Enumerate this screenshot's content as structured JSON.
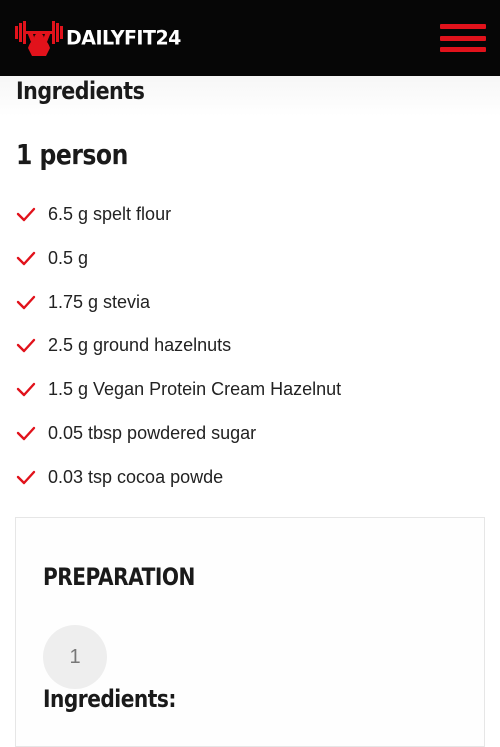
{
  "header": {
    "logo_text": "DAILYFIT24",
    "logo_icon": "bodybuilder-barbell-icon",
    "menu_icon": "hamburger-menu-icon",
    "accent_color": "#e1121b"
  },
  "ingredients": {
    "title": "Ingredients",
    "servings": "1 person",
    "check_icon": "checkmark-icon",
    "items": [
      "6.5 g spelt flour",
      "0.5 g",
      "1.75 g stevia",
      "2.5 g ground hazelnuts",
      "1.5 g Vegan Protein Cream Hazelnut",
      "0.05 tbsp powdered sugar",
      "0.03 tsp cocoa powde"
    ]
  },
  "preparation": {
    "title": "PREPARATION",
    "steps": [
      {
        "number": "1",
        "text": "Ingredients:"
      }
    ]
  }
}
